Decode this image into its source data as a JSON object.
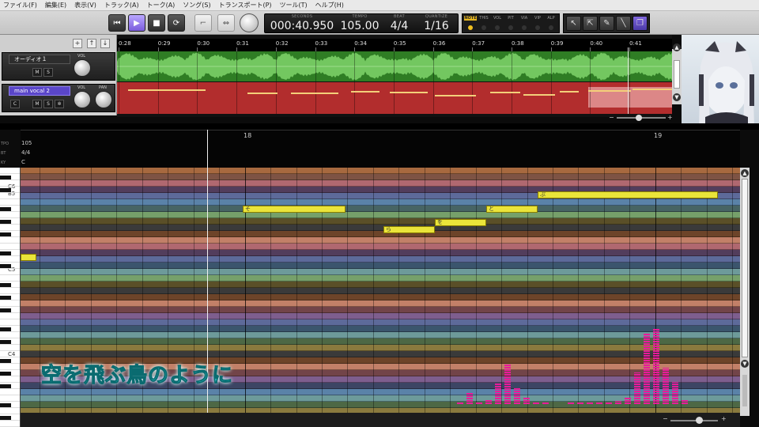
{
  "menu": [
    "ファイル(F)",
    "編集(E)",
    "表示(V)",
    "トラック(A)",
    "トーク(A)",
    "ソング(S)",
    "トランスポート(P)",
    "ツール(T)",
    "ヘルプ(H)"
  ],
  "display": {
    "seconds_label": "SECONDS",
    "seconds": "000:40.950",
    "tempo_label": "TEMPO",
    "tempo": "105.00",
    "beat_label": "BEAT",
    "beat": "4/4",
    "quantize_label": "QUANTIZE",
    "quantize": "1/16"
  },
  "modes": [
    "NOTE",
    "THIS",
    "VOL",
    "PIT",
    "VIA",
    "VIP",
    "ALP"
  ],
  "tracks": {
    "audio": {
      "name": "オーディオ１",
      "vol_label": "VOL",
      "m": "M",
      "s": "S"
    },
    "vocal": {
      "name": "main vocal 2",
      "vol_label": "VOL",
      "pan_label": "PAN",
      "c": "C",
      "m": "M",
      "s": "S"
    }
  },
  "timeline_labels": [
    "0:28",
    "0:29",
    "0:30",
    "0:31",
    "0:32",
    "0:33",
    "0:34",
    "0:35",
    "0:36",
    "0:37",
    "0:38",
    "0:39",
    "0:40",
    "0:41"
  ],
  "pr_header": {
    "tempo_label": "TPO",
    "tempo": "105",
    "beat_label": "BT",
    "beat": "4/4",
    "key_label": "KY",
    "key": "C"
  },
  "measures": [
    "18",
    "19"
  ],
  "key_labels": {
    "c6": "C6",
    "b5": "B5",
    "c5": "C5",
    "c4": "C4"
  },
  "notes": [
    {
      "lyric": ""
    },
    {
      "lyric": "そ"
    },
    {
      "lyric": "ら"
    },
    {
      "lyric": "を"
    },
    {
      "lyric": "と"
    },
    {
      "lyric": "ぶ"
    }
  ],
  "lyric_overlay": "空を飛ぶ鳥のように",
  "colors": {
    "accent": "#7a5bdc",
    "note": "#eae43a",
    "lyric": "#35e3ea",
    "meter": "#e81b9a"
  }
}
